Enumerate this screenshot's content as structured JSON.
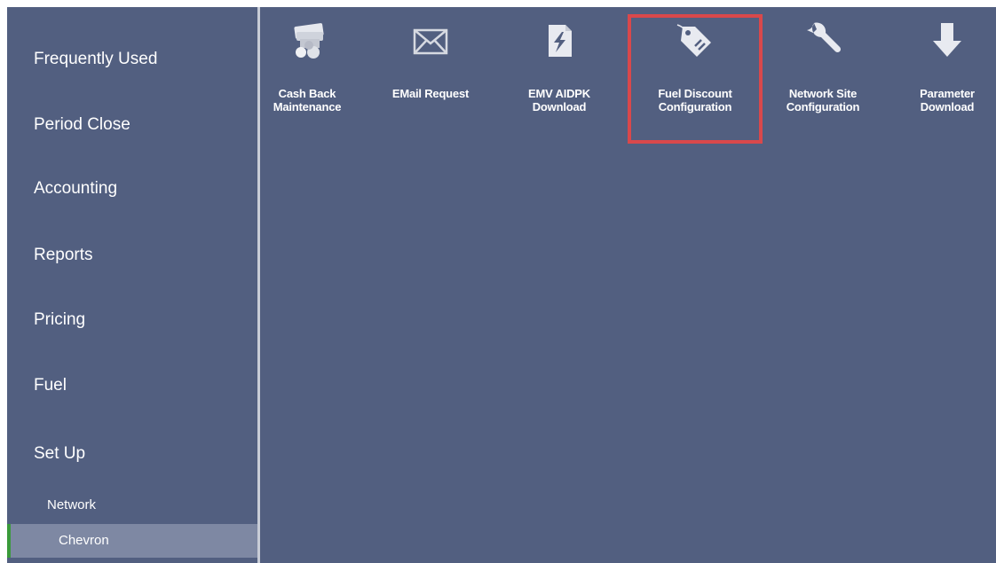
{
  "sidebar": {
    "items": [
      {
        "label": "Frequently Used"
      },
      {
        "label": "Period Close"
      },
      {
        "label": "Accounting"
      },
      {
        "label": "Reports"
      },
      {
        "label": "Pricing"
      },
      {
        "label": "Fuel"
      },
      {
        "label": "Set Up"
      }
    ],
    "subitems": [
      {
        "label": "Network"
      },
      {
        "label": "Chevron",
        "selected": true
      }
    ],
    "accent_color": "#3a9a3a"
  },
  "tiles": [
    {
      "label_line1": "Cash Back",
      "label_line2": "Maintenance",
      "icon": "cash-back-icon"
    },
    {
      "label_line1": "EMail Request",
      "label_line2": "",
      "icon": "envelope-icon"
    },
    {
      "label_line1": "EMV AIDPK",
      "label_line2": "Download",
      "icon": "document-icon"
    },
    {
      "label_line1": "Fuel Discount",
      "label_line2": "Configuration",
      "icon": "price-tag-icon",
      "highlighted": true
    },
    {
      "label_line1": "Network Site",
      "label_line2": "Configuration",
      "icon": "wrench-icon"
    },
    {
      "label_line1": "Parameter",
      "label_line2": "Download",
      "icon": "download-arrow-icon"
    }
  ],
  "colors": {
    "background": "#525f80",
    "highlight_border": "#d9484b",
    "selected_item": "#7e88a3"
  }
}
